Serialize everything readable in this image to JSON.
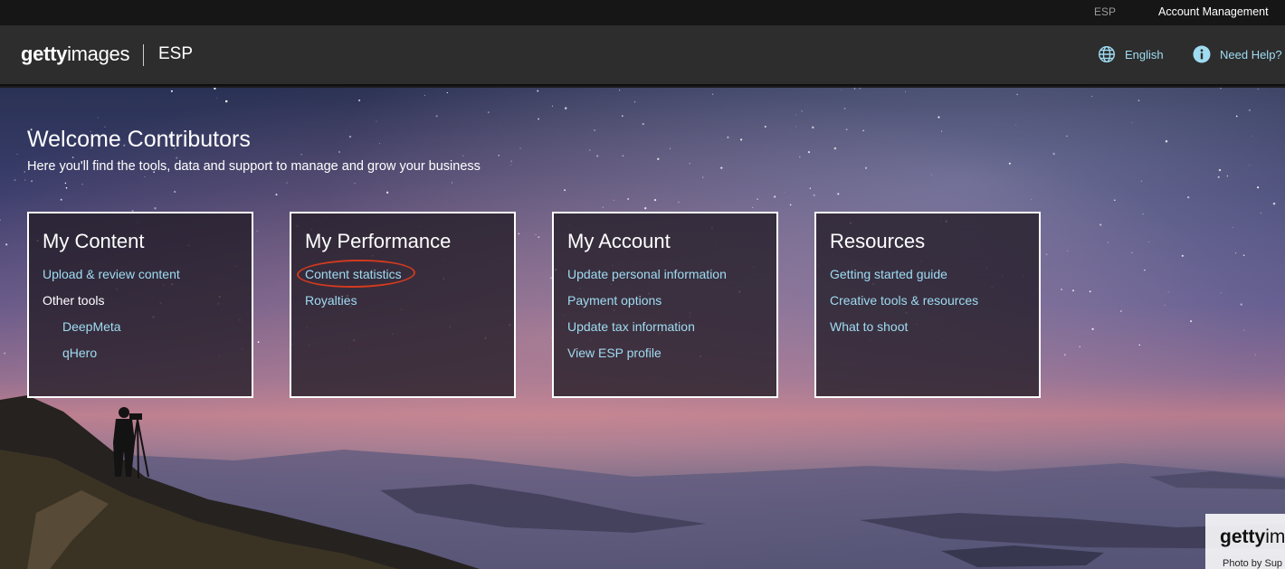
{
  "util_bar": {
    "esp": "ESP",
    "account_management": "Account Management"
  },
  "header": {
    "logo_bold": "getty",
    "logo_light": "images",
    "brand": "ESP",
    "language": "English",
    "help": "Need Help?"
  },
  "hero": {
    "title": "Welcome Contributors",
    "subtitle": "Here you'll find the tools, data and support to manage and grow your business"
  },
  "cards": {
    "content": {
      "title": "My Content",
      "upload": "Upload & review content",
      "other_tools": "Other tools",
      "deepmeta": "DeepMeta",
      "qhero": "qHero"
    },
    "performance": {
      "title": "My Performance",
      "statistics": "Content statistics",
      "royalties": "Royalties"
    },
    "account": {
      "title": "My Account",
      "personal": "Update personal information",
      "payment": "Payment options",
      "tax": "Update tax information",
      "profile": "View ESP profile"
    },
    "resources": {
      "title": "Resources",
      "guide": "Getting started guide",
      "tools": "Creative tools & resources",
      "shoot": "What to shoot"
    }
  },
  "watermark": {
    "logo_bold": "getty",
    "logo_light": "images",
    "credit": "Photo by Sup"
  },
  "colors": {
    "link": "#9fdcf2",
    "highlight_circle": "#d03a1f",
    "header_bg": "#2d2d2d"
  },
  "icons": {
    "language": "globe-icon",
    "help": "info-circle-icon"
  }
}
